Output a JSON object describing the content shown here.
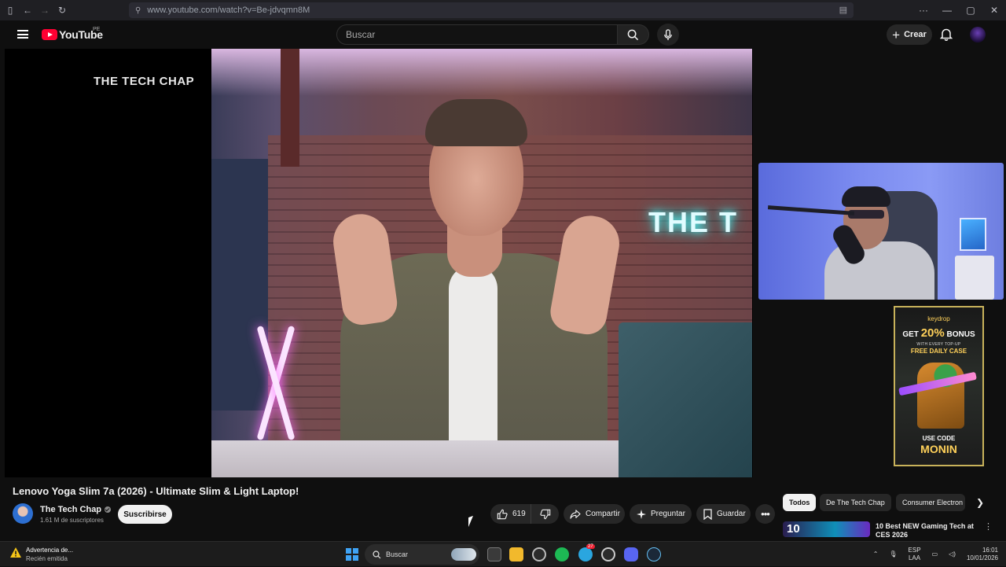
{
  "browser": {
    "url": "www.youtube.com/watch?v=Be-jdvqmn8M",
    "window_controls": [
      "···",
      "—",
      "▢",
      "✕"
    ]
  },
  "header": {
    "logo_text": "YouTube",
    "region": "PE",
    "search_placeholder": "Buscar",
    "create_label": "Crear"
  },
  "player": {
    "overlay_watermark": "THE TECH CHAP",
    "neon_sign": "THE T"
  },
  "ad": {
    "brand": "keydrop",
    "get_prefix": "GET",
    "percent": "20%",
    "bonus": "BONUS",
    "topup": "WITH EVERY TOP-UP",
    "free_case": "FREE DAILY CASE",
    "use_code": "USE CODE",
    "code": "MONIN"
  },
  "video": {
    "title": "Lenovo Yoga Slim 7a (2026) - Ultimate Slim & Light Laptop!",
    "channel_name": "The Tech Chap",
    "subscribers": "1.61 M de suscriptores",
    "subscribe_label": "Suscribirse",
    "likes": "619",
    "share_label": "Compartir",
    "ask_label": "Preguntar",
    "save_label": "Guardar"
  },
  "sidebar": {
    "chips": [
      "Todos",
      "De The Tech Chap",
      "Consumer Electron"
    ],
    "recommendation": {
      "thumb_text": "10",
      "title": "10 Best NEW Gaming Tech at CES 2026"
    }
  },
  "taskbar": {
    "notification_title": "Advertencia de...",
    "notification_sub": "Recién emitida",
    "search_label": "Buscar",
    "lang_top": "ESP",
    "lang_bottom": "LAA",
    "time": "16:01",
    "date": "10/01/2026",
    "app_badge_1": "27"
  },
  "colors": {
    "youtube_red": "#ff0033",
    "background": "#0f0f0f",
    "pill": "#272727",
    "ad_gold": "#ffd15a"
  }
}
